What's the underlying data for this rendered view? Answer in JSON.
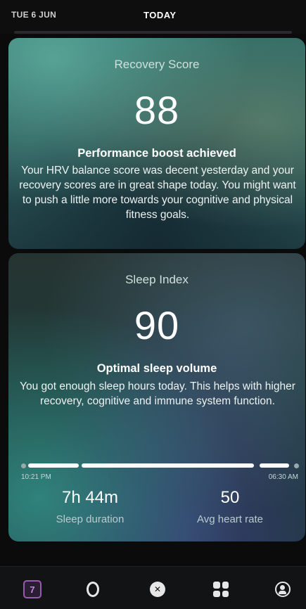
{
  "header": {
    "date": "TUE 6 JUN",
    "title": "TODAY"
  },
  "recovery": {
    "title": "Recovery Score",
    "score": "88",
    "headline": "Performance boost achieved",
    "body": "Your HRV balance score was decent yesterday and your recovery scores are in great shape today. You might want to push a little more towards your cognitive and physical fitness goals."
  },
  "sleep": {
    "title": "Sleep Index",
    "score": "90",
    "headline": "Optimal sleep volume",
    "body": "You got enough sleep hours today. This helps with higher recovery, cognitive and immune system function.",
    "start_time": "10:21 PM",
    "end_time": "06:30 AM",
    "duration_value": "7h 44m",
    "duration_label": "Sleep duration",
    "heart_value": "50",
    "heart_label": "Avg heart rate"
  },
  "tabbar": {
    "items": [
      {
        "icon": "calendar-icon",
        "label": "7"
      },
      {
        "icon": "ring-icon"
      },
      {
        "icon": "circle-x-icon"
      },
      {
        "icon": "grid-icon"
      },
      {
        "icon": "profile-icon"
      }
    ]
  },
  "colors": {
    "accent": "#9b59b6",
    "background": "#0b0b0c"
  }
}
